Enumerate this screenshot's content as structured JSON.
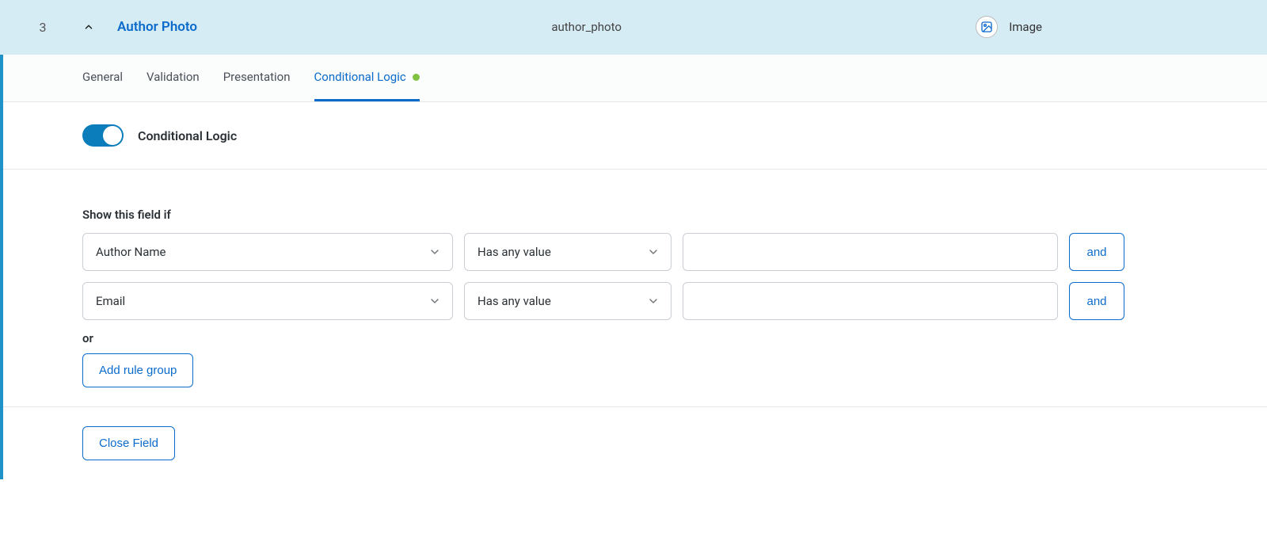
{
  "header": {
    "order": "3",
    "title": "Author Photo",
    "slug": "author_photo",
    "type_label": "Image"
  },
  "tabs": {
    "general": "General",
    "validation": "Validation",
    "presentation": "Presentation",
    "conditional_logic": "Conditional Logic"
  },
  "conditional": {
    "toggle_label": "Conditional Logic",
    "enabled": true,
    "heading": "Show this field if",
    "rules": [
      {
        "field": "Author Name",
        "operator": "Has any value",
        "value": ""
      },
      {
        "field": "Email",
        "operator": "Has any value",
        "value": ""
      }
    ],
    "and_label": "and",
    "or_label": "or",
    "add_group_label": "Add rule group"
  },
  "footer": {
    "close_label": "Close Field"
  }
}
